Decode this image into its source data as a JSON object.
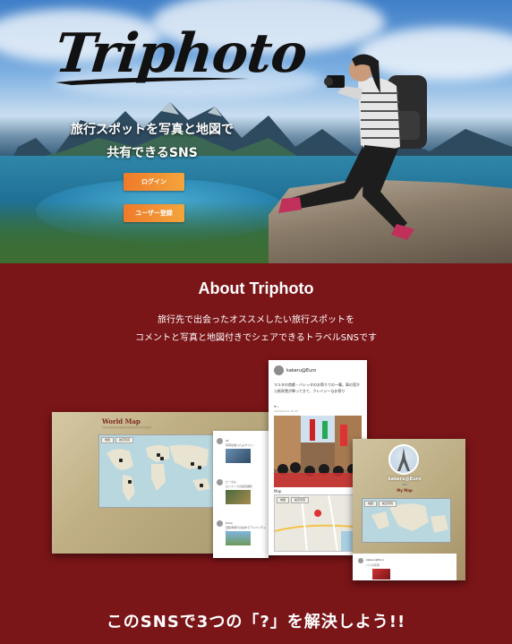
{
  "hero": {
    "logo_text": "Triphoto",
    "tagline_line1": "旅行スポットを写真と地図で",
    "tagline_line2": "共有できるSNS",
    "login_button": "ログイン",
    "register_button": "ユーザー登録"
  },
  "about": {
    "title": "About Triphoto",
    "desc_line1": "旅行先で出会ったオススメしたい旅行スポットを",
    "desc_line2": "コメントと写真と地図付きでシェアできるトラベルSNSです"
  },
  "mockups": {
    "map_card": {
      "title": "World Map",
      "subtitle": "○○○○○○○○○○○○○○○○○○○○○",
      "tab_map": "地図",
      "tab_satellite": "航空写真"
    },
    "list_panel": {
      "items": [
        {
          "name": "kk",
          "text": "写真を撮ったよカフェ…"
        },
        {
          "name": "じーさん",
          "text": "ロンドンでの記念撮影"
        },
        {
          "name": "tomo",
          "text": "自転車旅行の途中でアドベンチャー"
        }
      ]
    },
    "post_card": {
      "user": "kakeru@Euro",
      "text": "マルタの首都・バレッタのお祭りでの一幕。車の窓から紙吹雪が降ってきて、クレイジーなお祭り",
      "likes": "♥ 1",
      "date": "2019/01/01 10:23",
      "map_label": "Map",
      "tab_map": "地図",
      "tab_satellite": "航空写真"
    },
    "profile_card": {
      "name": "kakeru@Euro",
      "link": "Info",
      "my_map": "My Map",
      "tab_map": "地図",
      "tab_satellite": "航空写真",
      "bottom_user": "kakeru@Euro",
      "bottom_text": "パリの写真"
    }
  },
  "cta": "このSNSで3つの「?」を解決しよう!!"
}
